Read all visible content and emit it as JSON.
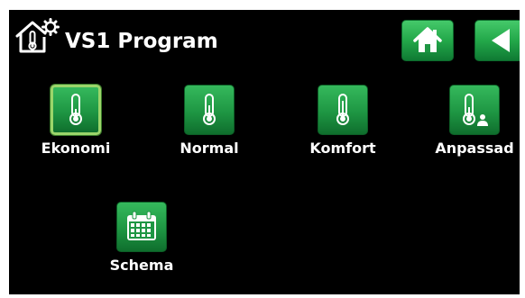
{
  "header": {
    "title": "VS1 Program",
    "icon": "house-thermometer-gear-icon"
  },
  "buttons": {
    "home_icon": "home-icon",
    "back_icon": "back-arrow-icon"
  },
  "programs": [
    {
      "label": "Ekonomi",
      "icon": "thermometer-icon",
      "selected": true
    },
    {
      "label": "Normal",
      "icon": "thermometer-icon",
      "selected": false
    },
    {
      "label": "Komfort",
      "icon": "thermometer-icon",
      "selected": false
    },
    {
      "label": "Anpassad",
      "icon": "thermometer-user-icon",
      "selected": false
    },
    {
      "label": "Schema",
      "icon": "calendar-icon",
      "selected": false
    }
  ],
  "colors": {
    "background": "#000000",
    "button_green": "#1e9643",
    "selected_outline": "#9bd56a"
  }
}
